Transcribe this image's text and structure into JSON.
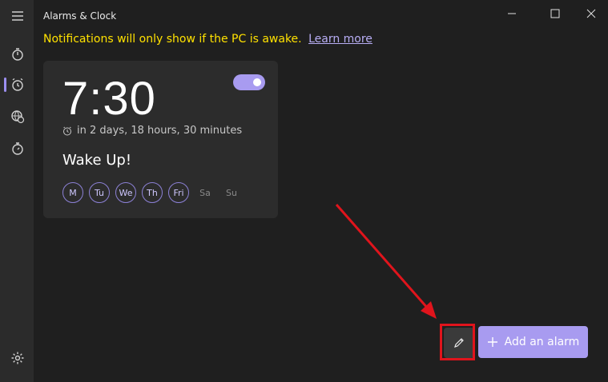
{
  "window": {
    "title": "Alarms & Clock"
  },
  "nav": {
    "items": [
      {
        "name": "Focus sessions",
        "icon": "focus-timer-icon"
      },
      {
        "name": "Alarm",
        "icon": "alarm-icon",
        "selected": true
      },
      {
        "name": "World clock",
        "icon": "globe-clock-icon"
      },
      {
        "name": "Stopwatch",
        "icon": "stopwatch-icon"
      }
    ],
    "settings_icon": "gear-icon"
  },
  "notice": {
    "text": "Notifications will only show if the PC is awake.",
    "link": "Learn more"
  },
  "alarm": {
    "time": "7:30",
    "enabled": true,
    "remaining": "in 2 days, 18 hours, 30 minutes",
    "name": "Wake Up!",
    "days": [
      {
        "label": "M",
        "active": true
      },
      {
        "label": "Tu",
        "active": true
      },
      {
        "label": "We",
        "active": true
      },
      {
        "label": "Th",
        "active": true
      },
      {
        "label": "Fri",
        "active": true
      },
      {
        "label": "Sa",
        "active": false
      },
      {
        "label": "Su",
        "active": false
      }
    ]
  },
  "footer": {
    "edit_icon": "pencil-icon",
    "add_label": "Add an alarm"
  },
  "colors": {
    "accent": "#a89bf0",
    "notice": "#ffe100",
    "annotation": "#e0141c"
  }
}
